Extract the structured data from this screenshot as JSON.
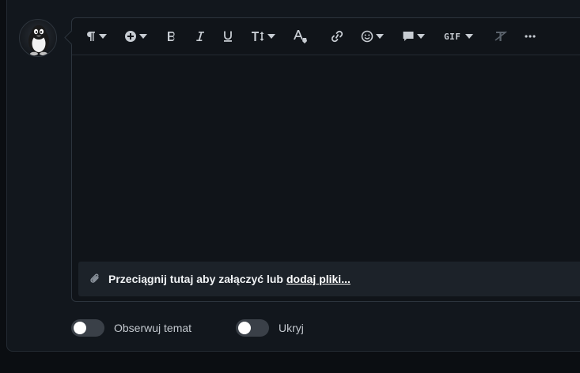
{
  "avatar": {
    "icon": "penguin-icon"
  },
  "toolbar": {
    "items": [
      {
        "name": "paragraph-format",
        "icon": "pilcrow-icon"
      },
      {
        "name": "insert",
        "icon": "plus-circle-icon"
      },
      {
        "name": "bold",
        "icon": "bold-icon"
      },
      {
        "name": "italic",
        "icon": "italic-icon"
      },
      {
        "name": "underline",
        "icon": "underline-icon"
      },
      {
        "name": "text-size",
        "icon": "text-size-icon"
      },
      {
        "name": "text-color",
        "icon": "text-color-icon"
      },
      {
        "name": "link",
        "icon": "link-icon"
      },
      {
        "name": "emoji",
        "icon": "smiley-icon"
      },
      {
        "name": "quote",
        "icon": "speech-bubble-icon"
      },
      {
        "name": "gif",
        "label": "GIF"
      },
      {
        "name": "clear-format",
        "icon": "clear-format-icon"
      },
      {
        "name": "more",
        "icon": "ellipsis-icon"
      }
    ]
  },
  "attachments": {
    "prompt": "Przeciągnij tutaj aby załączyć lub",
    "link": "dodaj pliki..."
  },
  "options": {
    "watch_label": "Obserwuj temat",
    "hide_label": "Ukryj"
  }
}
